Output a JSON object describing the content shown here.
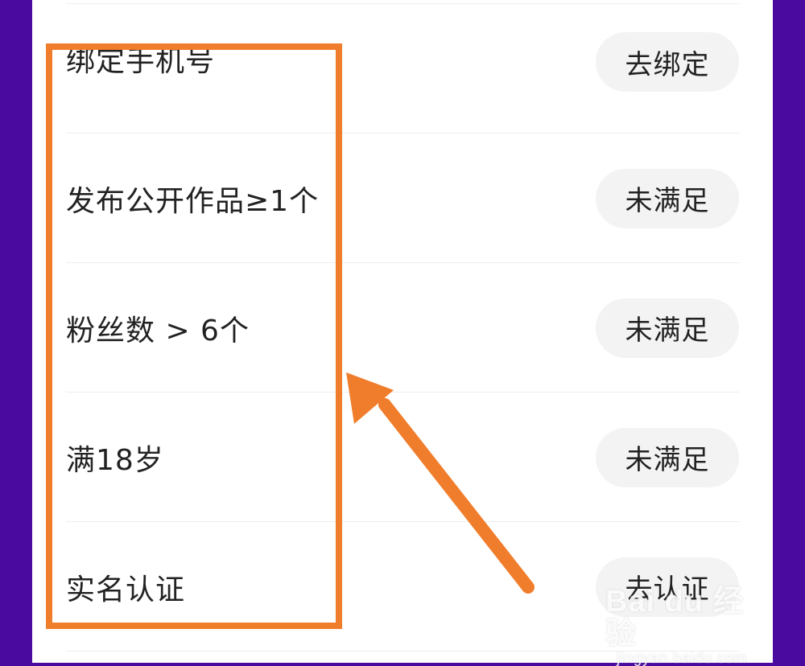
{
  "requirements": [
    {
      "label": "绑定手机号",
      "status": "去绑定"
    },
    {
      "label": "发布公开作品≥1个",
      "status": "未满足"
    },
    {
      "label": "粉丝数 > 6个",
      "status": "未满足"
    },
    {
      "label": "满18岁",
      "status": "未满足"
    },
    {
      "label": "实名认证",
      "status": "去认证"
    }
  ],
  "annotation": {
    "color": "#f07d2c"
  },
  "watermark": {
    "brand": "Bai du 经验",
    "domain": "jingyan.baidu.com"
  },
  "colors": {
    "background": "#4a0aa0",
    "panel": "#ffffff",
    "button_bg": "#f3f3f3",
    "text": "#222222"
  }
}
